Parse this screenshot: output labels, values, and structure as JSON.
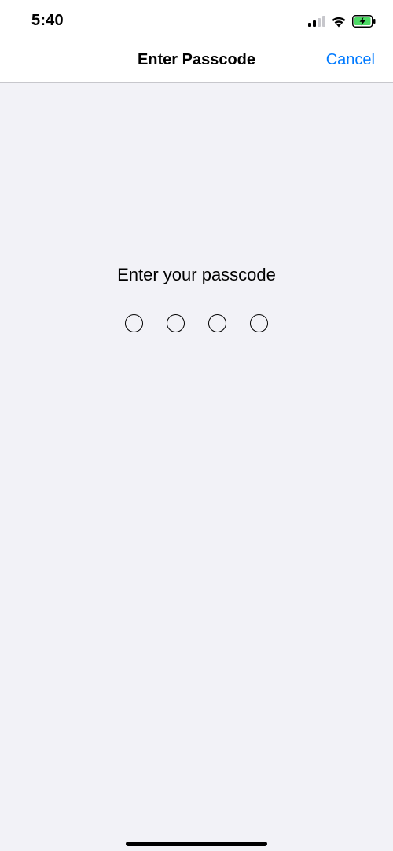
{
  "status_bar": {
    "time": "5:40",
    "icons": [
      "cellular-signal-icon",
      "wifi-icon",
      "battery-charging-icon"
    ],
    "battery_color": "#4cd964"
  },
  "nav": {
    "title": "Enter Passcode",
    "cancel_label": "Cancel"
  },
  "passcode": {
    "prompt": "Enter your passcode",
    "digits_total": 4,
    "digits_entered": 0
  },
  "colors": {
    "accent": "#007aff",
    "background": "#f2f2f7",
    "bar_background": "#ffffff"
  }
}
